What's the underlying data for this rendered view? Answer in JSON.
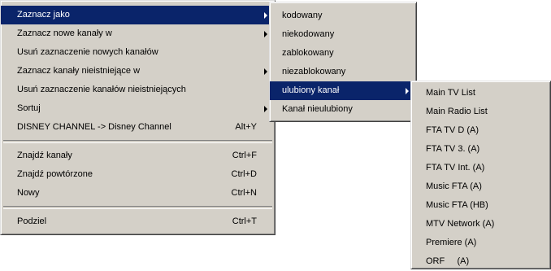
{
  "menu1": {
    "items": [
      {
        "label": "Zaznacz jako",
        "shortcut": "",
        "submenu": true,
        "highlighted": true
      },
      {
        "label": "Zaznacz nowe kanały w",
        "shortcut": "",
        "submenu": true,
        "highlighted": false
      },
      {
        "label": "Usuń zaznaczenie nowych kanałów",
        "shortcut": "",
        "submenu": false,
        "highlighted": false
      },
      {
        "label": "Zaznacz kanały nieistniejące w",
        "shortcut": "",
        "submenu": true,
        "highlighted": false
      },
      {
        "label": "Usuń zaznaczenie kanałów nieistniejących",
        "shortcut": "",
        "submenu": false,
        "highlighted": false
      },
      {
        "label": "Sortuj",
        "shortcut": "",
        "submenu": true,
        "highlighted": false
      },
      {
        "label": "DISNEY CHANNEL -> Disney Channel",
        "shortcut": "Alt+Y",
        "submenu": false,
        "highlighted": false
      },
      {
        "label": "Znajdź kanały",
        "shortcut": "Ctrl+F",
        "submenu": false,
        "highlighted": false
      },
      {
        "label": "Znajdź powtórzone",
        "shortcut": "Ctrl+D",
        "submenu": false,
        "highlighted": false
      },
      {
        "label": "Nowy",
        "shortcut": "Ctrl+N",
        "submenu": false,
        "highlighted": false
      },
      {
        "label": "Podziel",
        "shortcut": "Ctrl+T",
        "submenu": false,
        "highlighted": false
      }
    ]
  },
  "menu2": {
    "items": [
      {
        "label": "kodowany",
        "submenu": false,
        "highlighted": false
      },
      {
        "label": "niekodowany",
        "submenu": false,
        "highlighted": false
      },
      {
        "label": "zablokowany",
        "submenu": false,
        "highlighted": false
      },
      {
        "label": "niezablokowany",
        "submenu": false,
        "highlighted": false
      },
      {
        "label": "ulubiony kanał",
        "submenu": true,
        "highlighted": true
      },
      {
        "label": "Kanał nieulubiony",
        "submenu": false,
        "highlighted": false
      }
    ]
  },
  "menu3": {
    "items": [
      {
        "label": "Main TV List"
      },
      {
        "label": "Main Radio List"
      },
      {
        "label": "FTA TV D (A)"
      },
      {
        "label": "FTA TV 3. (A)"
      },
      {
        "label": "FTA TV Int. (A)"
      },
      {
        "label": "Music FTA (A)"
      },
      {
        "label": "Music FTA (HB)"
      },
      {
        "label": "MTV Network (A)"
      },
      {
        "label": "Premiere (A)"
      },
      {
        "label": "ORF     (A)"
      }
    ]
  },
  "colors": {
    "menu_bg": "#d4d0c8",
    "highlight_bg": "#0a246a",
    "highlight_text": "#ffffff"
  },
  "icons": {
    "submenu_arrow": "arrow-right-icon"
  }
}
